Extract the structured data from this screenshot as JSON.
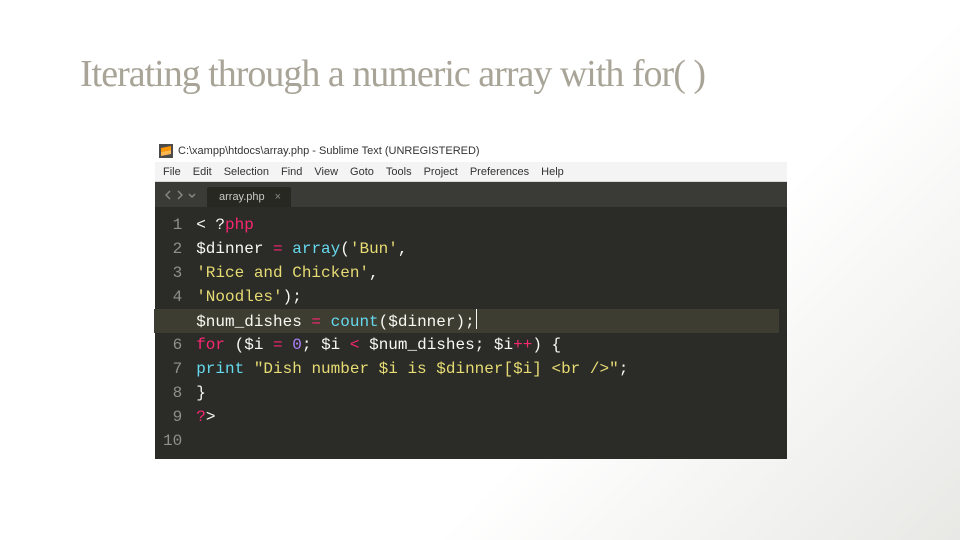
{
  "slide": {
    "title": "Iterating through a numeric array with for( )"
  },
  "editor": {
    "title": "C:\\xampp\\htdocs\\array.php - Sublime Text (UNREGISTERED)",
    "menu": [
      "File",
      "Edit",
      "Selection",
      "Find",
      "View",
      "Goto",
      "Tools",
      "Project",
      "Preferences",
      "Help"
    ],
    "tab_label": "array.php",
    "tab_close": "×",
    "line_count": 10,
    "code": {
      "l1_a": "< ?",
      "l1_b": "php",
      "l2_a": "$dinner ",
      "l2_b": "=",
      "l2_c": " ",
      "l2_d": "array",
      "l2_e": "(",
      "l2_f": "'Bun'",
      "l2_g": ",",
      "l3_a": "'Rice and Chicken'",
      "l3_b": ",",
      "l4_a": "'Noodles'",
      "l4_b": ");",
      "l5_a": "$num_dishes ",
      "l5_b": "=",
      "l5_c": " ",
      "l5_d": "count",
      "l5_e": "($dinner);",
      "l6_a": "for",
      "l6_b": " ($i ",
      "l6_c": "=",
      "l6_d": " ",
      "l6_e": "0",
      "l6_f": "; $i ",
      "l6_g": "<",
      "l6_h": " $num_dishes; $i",
      "l6_i": "++",
      "l6_j": ") {",
      "l7_a": "print",
      "l7_b": " ",
      "l7_c": "\"Dish number $i is $dinner[$i] <br />\"",
      "l7_d": ";",
      "l8_a": "}",
      "l9_a": "?",
      "l9_b": ">"
    }
  }
}
